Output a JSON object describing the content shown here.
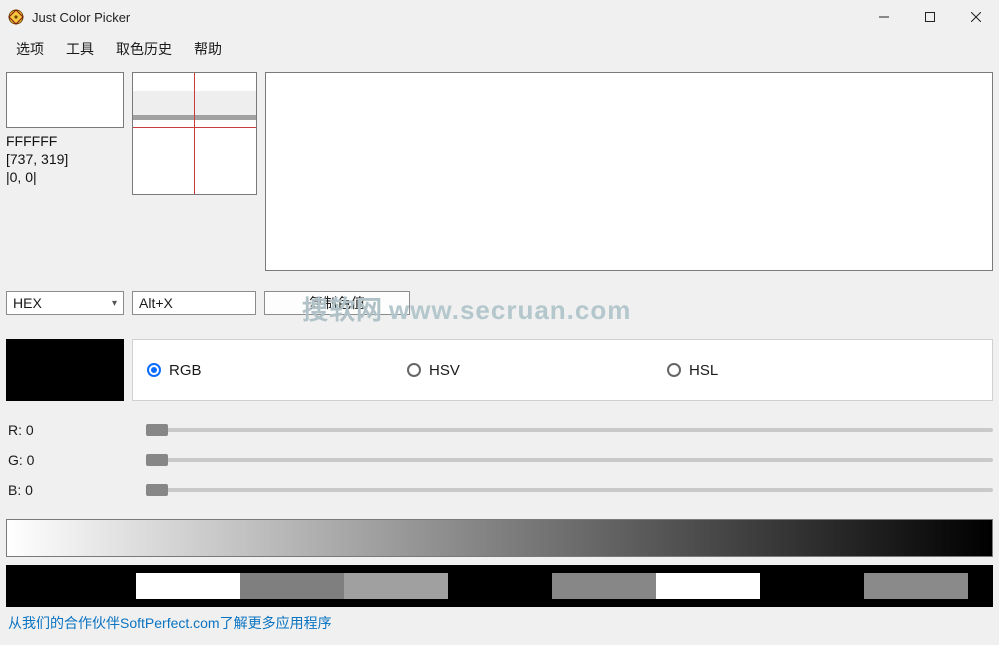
{
  "window": {
    "title": "Just Color Picker"
  },
  "menu": {
    "items": [
      "选项",
      "工具",
      "取色历史",
      "帮助"
    ]
  },
  "picked": {
    "hex": "FFFFFF",
    "coords": "[737, 319]",
    "offset": "|0, 0|"
  },
  "controls": {
    "format": "HEX",
    "hotkey": "Alt+X",
    "copy_label": "复制色值"
  },
  "color_models": {
    "selected": "RGB",
    "options": [
      "RGB",
      "HSV",
      "HSL"
    ]
  },
  "channels": {
    "r": {
      "label": "R: 0",
      "value": 0
    },
    "g": {
      "label": "G: 0",
      "value": 0
    },
    "b": {
      "label": "B: 0",
      "value": 0
    }
  },
  "palette": [
    "#000000",
    "#ffffff",
    "#7f7f7f",
    "#a0a0a0",
    "#000000",
    "#878787",
    "#ffffff",
    "#000000",
    "#8a8a8a",
    "#6b6b6b"
  ],
  "footer": {
    "text": "从我们的合作伙伴SoftPerfect.com了解更多应用程序"
  },
  "watermark": {
    "cn": "搜软网",
    "domain": "www.secruan.com"
  }
}
